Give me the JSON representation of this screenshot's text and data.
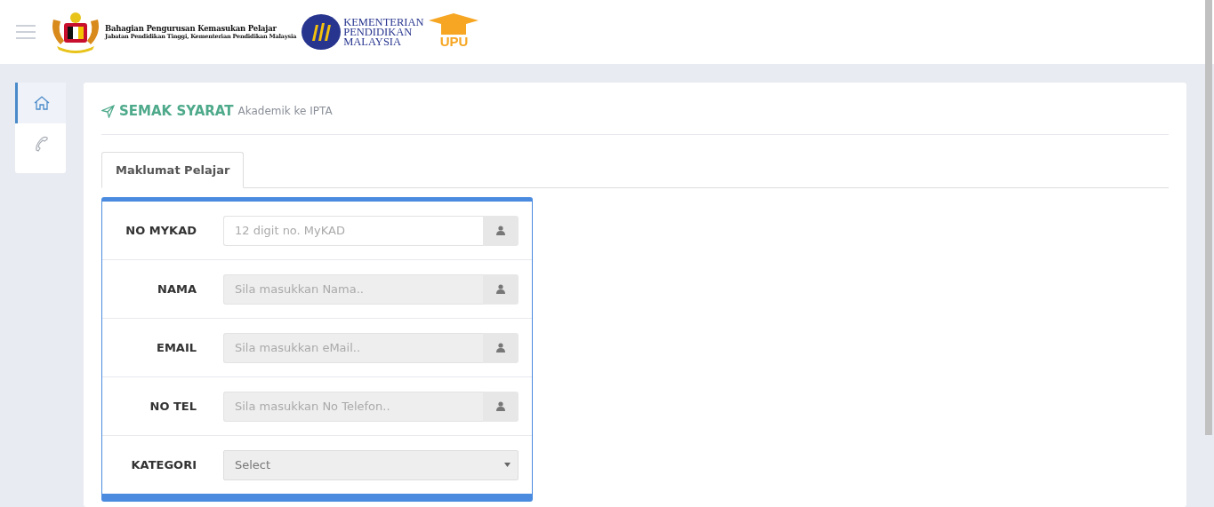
{
  "header": {
    "agency_title": "Bahagian Pengurusan Kemasukan Pelajar",
    "agency_subtitle": "Jabatan Pendidikan Tinggi, Kementerian Pendidikan Malaysia",
    "ministry_lines": [
      "KEMENTERIAN",
      "PENDIDIKAN",
      "MALAYSIA"
    ],
    "upu_logo": "UPU"
  },
  "sidebar": {
    "items": [
      {
        "kind": "home",
        "selected": true
      },
      {
        "kind": "phone",
        "selected": false
      }
    ]
  },
  "page": {
    "title": "SEMAK SYARAT",
    "subtitle": "Akademik ke IPTA"
  },
  "tabs": [
    {
      "label": "Maklumat Pelajar",
      "selected": true
    }
  ],
  "form": {
    "fields": [
      {
        "label": "NO MYKAD",
        "kind": "input",
        "placeholder": "12 digit no. MyKAD",
        "disabled": false
      },
      {
        "label": "NAMA",
        "kind": "input",
        "placeholder": "Sila masukkan Nama..",
        "disabled": true
      },
      {
        "label": "EMAIL",
        "kind": "input",
        "placeholder": "Sila masukkan eMail..",
        "disabled": true
      },
      {
        "label": "NO TEL",
        "kind": "input",
        "placeholder": "Sila masukkan No Telefon..",
        "disabled": true
      },
      {
        "label": "KATEGORI",
        "kind": "select",
        "value": "Select",
        "disabled": true
      }
    ]
  }
}
